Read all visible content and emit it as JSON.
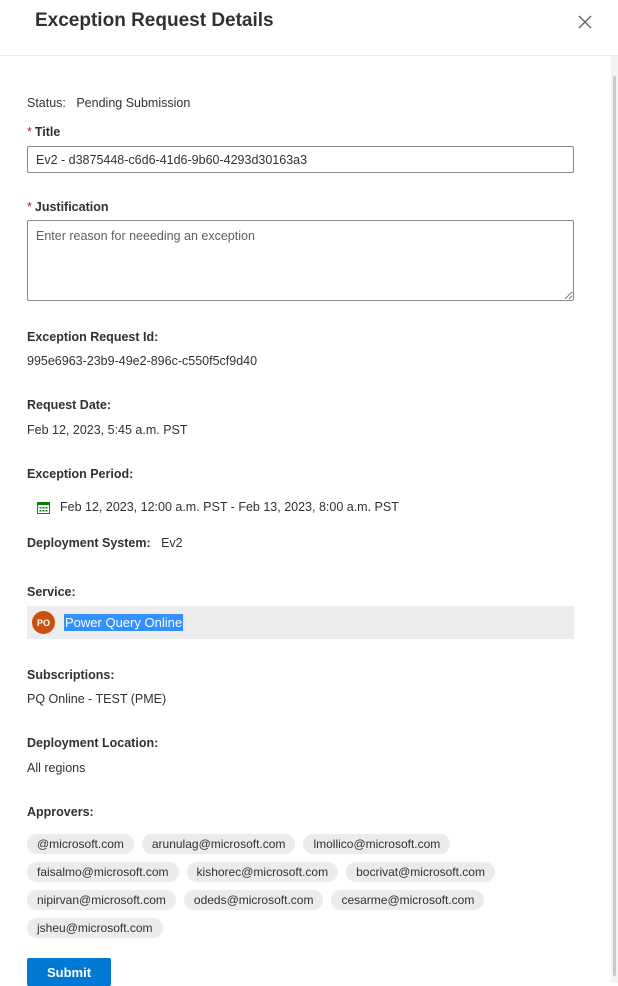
{
  "header": {
    "title": "Exception Request Details"
  },
  "status": {
    "label": "Status:",
    "value": "Pending Submission"
  },
  "title_field": {
    "required": "*",
    "label": "Title",
    "value": "Ev2 - d3875448-c6d6-41d6-9b60-4293d30163a3"
  },
  "justification": {
    "required": "*",
    "label": "Justification",
    "placeholder": "Enter reason for neeeding an exception"
  },
  "exception_id": {
    "label": "Exception Request Id:",
    "value": "995e6963-23b9-49e2-896c-c550f5cf9d40"
  },
  "request_date": {
    "label": "Request Date:",
    "value": "Feb 12, 2023, 5:45 a.m. PST"
  },
  "exception_period": {
    "label": "Exception Period:",
    "value": "Feb 12, 2023, 12:00 a.m. PST - Feb 13, 2023, 8:00 a.m. PST"
  },
  "deployment_system": {
    "label": "Deployment System:",
    "value": "Ev2"
  },
  "service": {
    "label": "Service:",
    "initials": "PO",
    "name": "Power Query Online",
    "avatar_color": "#ca5010"
  },
  "subscriptions": {
    "label": "Subscriptions:",
    "value": "PQ Online - TEST (PME)"
  },
  "deployment_location": {
    "label": "Deployment Location:",
    "value": "All regions"
  },
  "approvers": {
    "label": "Approvers:",
    "items": [
      "@microsoft.com",
      "arunulag@microsoft.com",
      "lmollico@microsoft.com",
      "faisalmo@microsoft.com",
      "kishorec@microsoft.com",
      "bocrivat@microsoft.com",
      "nipirvan@microsoft.com",
      "odeds@microsoft.com",
      "cesarme@microsoft.com",
      "jsheu@microsoft.com"
    ]
  },
  "submit_label": "Submit",
  "colors": {
    "accent": "#0078d4",
    "required": "#a4262c"
  }
}
